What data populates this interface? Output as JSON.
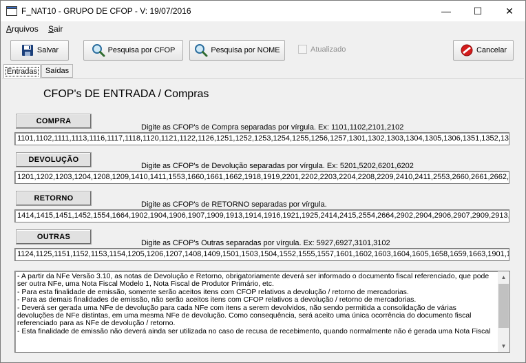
{
  "window": {
    "title": "F_NAT10 - GRUPO DE CFOP - V: 19/07/2016",
    "minimize": "—",
    "maximize": "☐",
    "close": "✕"
  },
  "menu": {
    "arquivos_rest": "rquivos",
    "arquivos_key": "A",
    "sair_key": "S",
    "sair_rest": "air"
  },
  "toolbar": {
    "salvar": "Salvar",
    "pesquisa_cfop": "Pesquisa por CFOP",
    "pesquisa_nome": "Pesquisa por NOME",
    "atualizado": "Atualizado",
    "atualizado_checked": false,
    "cancelar": "Cancelar"
  },
  "tabs": {
    "entradas": "Entradas",
    "saidas": "Saídas"
  },
  "heading": "CFOP's DE ENTRADA / Compras",
  "sections": {
    "compra": {
      "button": "COMPRA",
      "hint": "Digite as CFOP's de Compra separadas por vírgula.   Ex: 1101,1102,2101,2102",
      "value": "1101,1102,1111,1113,1116,1117,1118,1120,1121,1122,1126,1251,1252,1253,1254,1255,1256,1257,1301,1302,1303,1304,1305,1306,1351,1352,13"
    },
    "devolucao": {
      "button": "DEVOLUÇÃO",
      "hint": "Digite as CFOP's de Devolução separadas por vírgula.   Ex: 5201,5202,6201,6202",
      "value": "1201,1202,1203,1204,1208,1209,1410,1411,1553,1660,1661,1662,1918,1919,2201,2202,2203,2204,2208,2209,2410,2411,2553,2660,2661,2662,29"
    },
    "retorno": {
      "button": "RETORNO",
      "hint": "Digite as CFOP's de RETORNO separadas por vírgula.",
      "value": "1414,1415,1451,1452,1554,1664,1902,1904,1906,1907,1909,1913,1914,1916,1921,1925,2414,2415,2554,2664,2902,2904,2906,2907,2909,2913,29"
    },
    "outras": {
      "button": "OUTRAS",
      "hint": "Digite as CFOP's Outras separadas por vírgula.   Ex: 5927,6927,3101,3102",
      "value": "1124,1125,1151,1152,1153,1154,1205,1206,1207,1408,1409,1501,1503,1504,1552,1555,1557,1601,1602,1603,1604,1605,1658,1659,1663,1901,19"
    }
  },
  "memo": {
    "lines": [
      "- A partir da NFe Versão 3.10, as notas de Devolução e Retorno, obrigatoriamente deverá ser informado o documento fiscal referenciado, que pode",
      "ser outra NFe, uma Nota Fiscal Modelo 1, Nota Fiscal de Produtor Primário, etc.",
      "- Para esta finalidade de emissão, somente serão aceitos itens com CFOP relativos a devolução / retorno de mercadorias.",
      "- Para as demais finalidades de emissão, não serão aceitos itens com CFOP relativos a devolução / retorno de mercadorias.",
      "- Deverá ser gerada uma NFe de devolução para cada NFe com itens a serem devolvidos, não sendo permitida a consolidação de várias",
      "devoluções de NFe distintas, em uma mesma NFe de devolução. Como consequência, será aceito uma única ocorrência do documento fiscal",
      "referenciado para as NFe de devolução / retorno.",
      "- Esta finalidade de emissão não deverá ainda ser utilizada no caso de recusa de recebimento, quando normalmente não é gerada uma Nota Fiscal"
    ]
  }
}
